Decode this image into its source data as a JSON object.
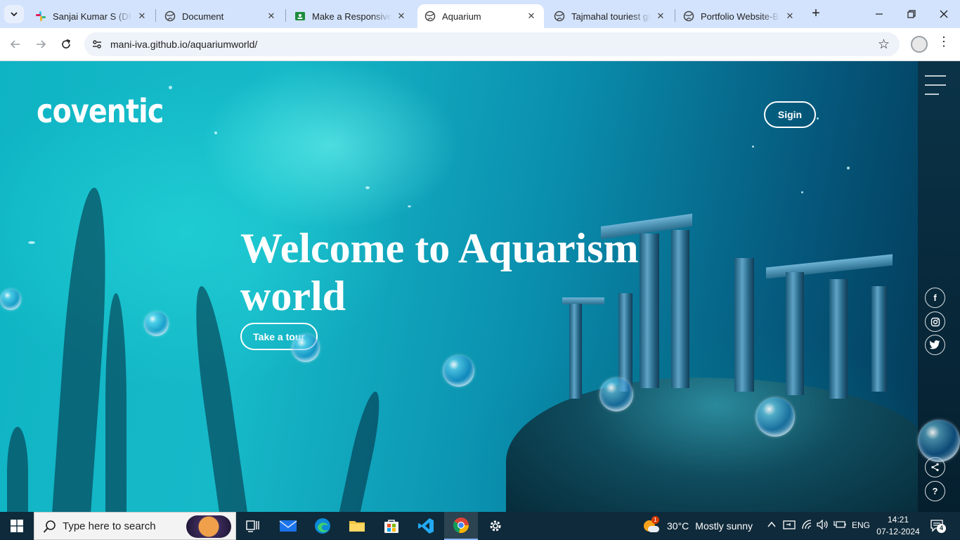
{
  "browser": {
    "tabs": [
      {
        "title": "Sanjai Kumar S (DM) -",
        "icon": "slack-icon",
        "active": false
      },
      {
        "title": "Document",
        "icon": "globe-icon",
        "active": false
      },
      {
        "title": "Make a Responsive W",
        "icon": "classroom-icon",
        "active": false
      },
      {
        "title": "Aquarium",
        "icon": "globe-icon",
        "active": true
      },
      {
        "title": "Tajmahal touriest gui",
        "icon": "globe-icon",
        "active": false
      },
      {
        "title": "Portfolio Website-Bra",
        "icon": "globe-icon",
        "active": false
      }
    ],
    "tab_close_glyph": "✕",
    "new_tab_glyph": "+",
    "url": "mani-iva.github.io/aquariumworld/"
  },
  "site": {
    "logo": "coventic",
    "signin_label": "Sigin",
    "hero_title_line1": "Welcome to Aquarism",
    "hero_title_line2": "world",
    "tour_label": "Take a tour",
    "social": [
      "facebook-icon",
      "instagram-icon",
      "twitter-icon"
    ],
    "share_label": "<",
    "help_label": "?"
  },
  "taskbar": {
    "search_placeholder": "Type here to search",
    "weather_badge": "1",
    "temperature": "30°C",
    "weather_text": "Mostly sunny",
    "language": "ENG",
    "time": "14:21",
    "date": "07-12-2024",
    "notification_count": "4"
  },
  "colors": {
    "tabstrip": "#d3e3fd",
    "page_accent": "#0fb4c4",
    "taskbar": "#0f2a3a"
  }
}
